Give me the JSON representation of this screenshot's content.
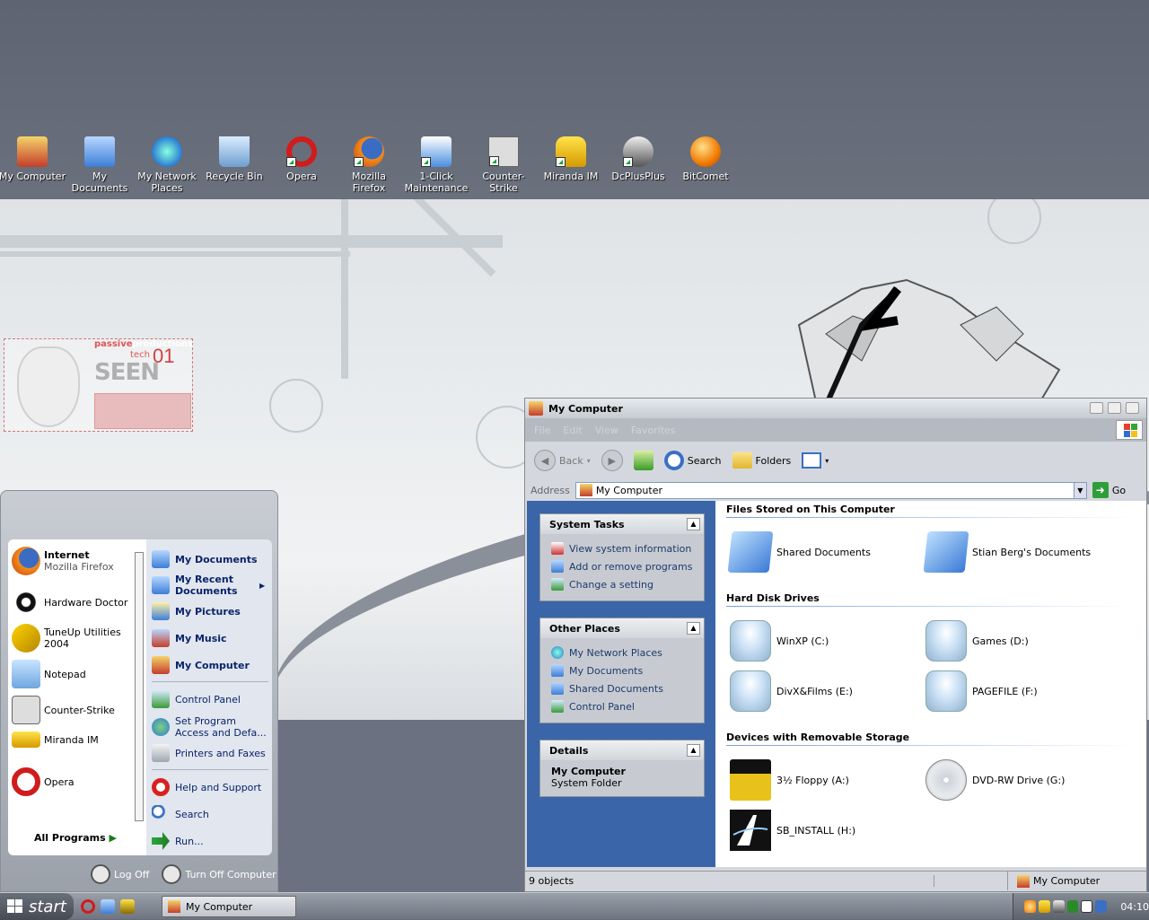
{
  "desktop_icons": [
    {
      "label": "My Computer",
      "icon": "my-computer-icon"
    },
    {
      "label": "My Documents",
      "icon": "my-documents-icon"
    },
    {
      "label": "My Network Places",
      "icon": "network-places-icon"
    },
    {
      "label": "Recycle Bin",
      "icon": "recycle-bin-icon"
    },
    {
      "label": "Opera",
      "icon": "opera-icon"
    },
    {
      "label": "Mozilla Firefox",
      "icon": "firefox-icon"
    },
    {
      "label": "1-Click Maintenance",
      "icon": "maintenance-icon"
    },
    {
      "label": "Counter-Strike",
      "icon": "counter-strike-icon"
    },
    {
      "label": "Miranda IM",
      "icon": "miranda-icon"
    },
    {
      "label": "DcPlusPlus",
      "icon": "dcplusplus-icon"
    },
    {
      "label": "BitComet",
      "icon": "bitcomet-icon"
    }
  ],
  "wallpaper": {
    "brand_small": "passive",
    "brand_small_accent": "productions",
    "brand_tech": "tech",
    "brand_main": "SEEN",
    "brand_number": "01"
  },
  "start_menu": {
    "pinned": [
      {
        "title": "Internet",
        "subtitle": "Mozilla Firefox"
      },
      {
        "title": "Hardware Doctor"
      },
      {
        "title": "TuneUp Utilities 2004"
      },
      {
        "title": "Notepad"
      },
      {
        "title": "Counter-Strike"
      },
      {
        "title": "Miranda IM"
      },
      {
        "title": "Opera"
      }
    ],
    "all_programs": "All Programs",
    "right": {
      "my_documents": "My Documents",
      "my_recent_documents": "My Recent Documents",
      "my_pictures": "My Pictures",
      "my_music": "My Music",
      "my_computer": "My Computer",
      "control_panel": "Control Panel",
      "set_program": "Set Program Access and Defa...",
      "printers": "Printers and Faxes",
      "help": "Help and Support",
      "search": "Search",
      "run": "Run..."
    },
    "log_off": "Log Off",
    "turn_off": "Turn Off Computer"
  },
  "window": {
    "title": "My Computer",
    "menu": [
      "File",
      "Edit",
      "View",
      "Favorites"
    ],
    "toolbar": {
      "back": "Back",
      "search": "Search",
      "folders": "Folders"
    },
    "address_label": "Address",
    "address_value": "My Computer",
    "go": "Go",
    "system_tasks": {
      "title": "System Tasks",
      "links": [
        "View system information",
        "Add or remove programs",
        "Change a setting"
      ]
    },
    "other_places": {
      "title": "Other Places",
      "links": [
        "My Network Places",
        "My Documents",
        "Shared Documents",
        "Control Panel"
      ]
    },
    "details": {
      "title": "Details",
      "name": "My Computer",
      "type": "System Folder"
    },
    "groups": {
      "files": "Files Stored on This Computer",
      "hdd": "Hard Disk Drives",
      "removable": "Devices with Removable Storage"
    },
    "files": [
      "Shared Documents",
      "Stian Berg's Documents"
    ],
    "drives": [
      "WinXP (C:)",
      "Games (D:)",
      "DivX&Films (E:)",
      "PAGEFILE (F:)"
    ],
    "removable": [
      "3½ Floppy (A:)",
      "DVD-RW Drive (G:)",
      "SB_INSTALL (H:)"
    ],
    "status_left": "9 objects",
    "status_right": "My Computer"
  },
  "taskbar": {
    "start": "start",
    "task": "My Computer",
    "clock": "04:10"
  }
}
